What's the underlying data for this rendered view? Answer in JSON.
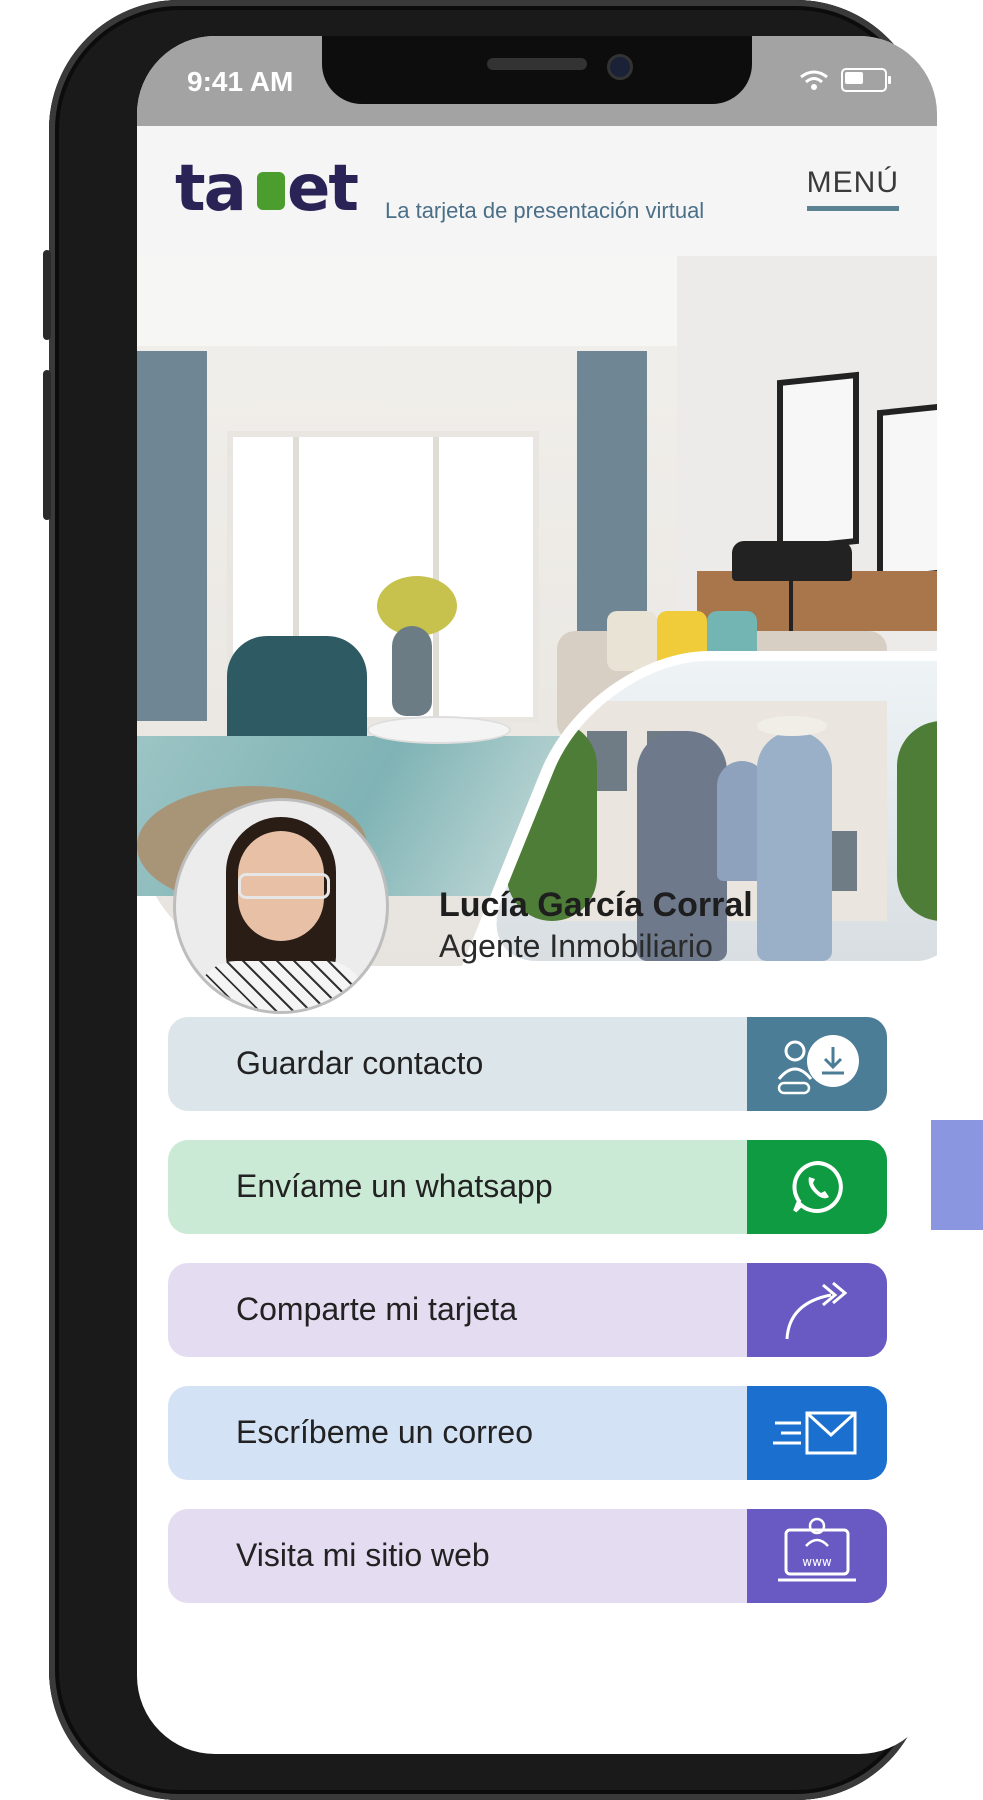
{
  "status_bar": {
    "time": "9:41 AM"
  },
  "header": {
    "logo_text": "tarjet",
    "tagline": "La tarjeta de presentación virtual",
    "menu_label": "MENÚ"
  },
  "profile": {
    "name": "Lucía García Corral",
    "role": "Agente Inmobiliario"
  },
  "actions": [
    {
      "label": "Guardar contacto",
      "icon": "save-contact-icon",
      "bg": "#dbe5ea",
      "icon_bg": "#4b7e96"
    },
    {
      "label": "Envíame un whatsapp",
      "icon": "whatsapp-icon",
      "bg": "#cbead5",
      "icon_bg": "#0f9b41"
    },
    {
      "label": "Comparte mi tarjeta",
      "icon": "share-arrow-icon",
      "bg": "#e4ddf2",
      "icon_bg": "#6959c2"
    },
    {
      "label": "Escríbeme un correo",
      "icon": "email-icon",
      "bg": "#d4e2f5",
      "icon_bg": "#1a6fcf"
    },
    {
      "label": "Visita mi sitio web",
      "icon": "website-icon",
      "bg": "#e4ddf2",
      "icon_bg": "#6959c2"
    }
  ],
  "colors": {
    "brand_dark": "#2a2456",
    "brand_green": "#4b9e2e",
    "menu_underline": "#5b8292"
  }
}
